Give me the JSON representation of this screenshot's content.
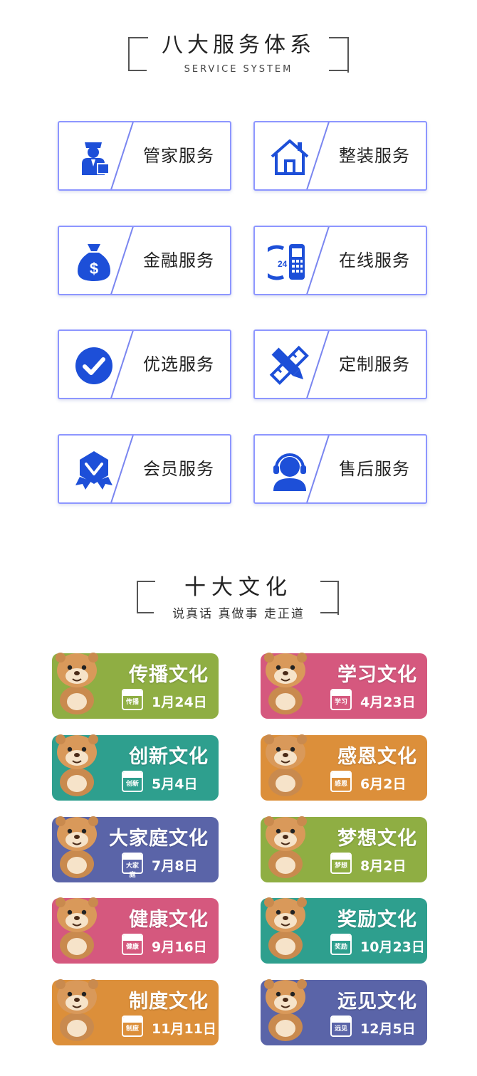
{
  "section1": {
    "title": "八大服务体系",
    "subtitle": "SERVICE SYSTEM"
  },
  "services": [
    {
      "label": "管家服务",
      "icon": "butler-icon"
    },
    {
      "label": "整装服务",
      "icon": "house-icon"
    },
    {
      "label": "金融服务",
      "icon": "money-bag-icon"
    },
    {
      "label": "在线服务",
      "icon": "phone-24h-icon"
    },
    {
      "label": "优选服务",
      "icon": "check-circle-icon"
    },
    {
      "label": "定制服务",
      "icon": "pencil-ruler-icon"
    },
    {
      "label": "会员服务",
      "icon": "badge-icon"
    },
    {
      "label": "售后服务",
      "icon": "headset-icon"
    }
  ],
  "section2": {
    "title": "十大文化",
    "subtitle": "说真话 真做事 走正道"
  },
  "cultures": [
    {
      "title": "传播文化",
      "tag": "传播",
      "date": "1月24日",
      "color": "#8fae43"
    },
    {
      "title": "学习文化",
      "tag": "学习",
      "date": "4月23日",
      "color": "#d5587e"
    },
    {
      "title": "创新文化",
      "tag": "创新",
      "date": "5月4日",
      "color": "#2e9f8e"
    },
    {
      "title": "感恩文化",
      "tag": "感恩",
      "date": "6月2日",
      "color": "#dc8f3a"
    },
    {
      "title": "大家庭文化",
      "tag": "大家庭",
      "date": "7月8日",
      "color": "#5a64a8"
    },
    {
      "title": "梦想文化",
      "tag": "梦想",
      "date": "8月2日",
      "color": "#8fae43"
    },
    {
      "title": "健康文化",
      "tag": "健康",
      "date": "9月16日",
      "color": "#d5587e"
    },
    {
      "title": "奖励文化",
      "tag": "奖励",
      "date": "10月23日",
      "color": "#2e9f8e"
    },
    {
      "title": "制度文化",
      "tag": "制度",
      "date": "11月11日",
      "color": "#dc8f3a"
    },
    {
      "title": "远见文化",
      "tag": "远见",
      "date": "12月5日",
      "color": "#5a64a8"
    }
  ],
  "icon_color": "#1d4fd8"
}
